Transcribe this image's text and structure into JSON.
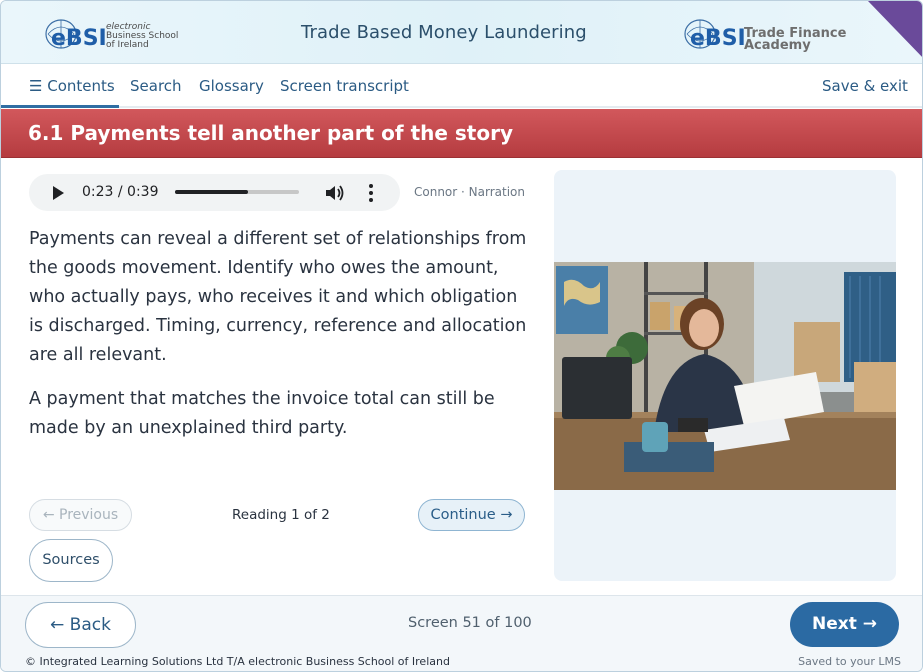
{
  "header": {
    "course_title": "Trade Based Money Laundering",
    "left_logo": {
      "mark": "eBSI",
      "line1": "electronic",
      "line2": "Business School",
      "line3": "of Ireland"
    },
    "right_logo": {
      "mark": "eBSI",
      "line1": "Trade Finance",
      "line2": "Academy"
    },
    "accent_color": "#6a4a9a"
  },
  "nav": {
    "contents": "☰ Contents",
    "search": "Search",
    "glossary": "Glossary",
    "transcript": "Screen transcript",
    "save_exit": "Save & exit"
  },
  "banner": {
    "title": "6.1 Payments tell another part of the story",
    "color": "#c44a4e"
  },
  "audio": {
    "time": "0:23 / 0:39",
    "progress": 0.59,
    "narration": "Connor · Narration"
  },
  "content": {
    "paragraphs": [
      "Payments can reveal a different set of relationships from the goods movement. Identify who owes the amount, who actually pays, who receives it and which obligation is discharged. Timing, currency, reference and allocation are all relevant.",
      "A payment that matches the invoice total can still be made by an unexplained third party."
    ]
  },
  "controls": {
    "previous": "← Previous",
    "reading": "Reading 1 of 2",
    "continue": "Continue →",
    "sources": "Sources"
  },
  "footer": {
    "back": "← Back",
    "screen": "Screen 51 of 100",
    "next": "Next →",
    "copyright": "© Integrated Learning Solutions Ltd T/A electronic Business School of Ireland",
    "saved": "Saved to your LMS",
    "primary_color": "#2b6aa3"
  }
}
